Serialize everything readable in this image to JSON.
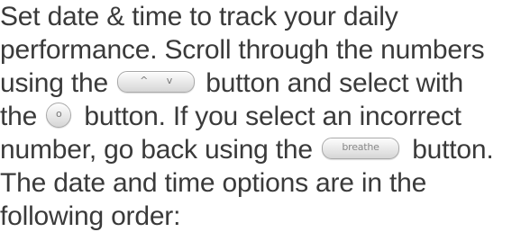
{
  "text": {
    "line1": "Set date & time to track your daily",
    "line2": "performance. Scroll through the numbers",
    "line3_before": "using the",
    "line3_after": "button and select with",
    "line4_before": "the",
    "line4_after": "button. If you select an incorrect",
    "line5_before": "number, go back using the",
    "line5_after": "button.",
    "line6": "The date and time options are in the",
    "line7": "following order:"
  },
  "buttons": {
    "scroll": {
      "icon_up": "chevron-up-icon",
      "icon_down": "chevron-down-icon",
      "up_glyph": "^",
      "down_glyph": "v"
    },
    "select": {
      "icon": "circle-icon",
      "glyph": "o"
    },
    "breathe": {
      "label": "breathe"
    }
  },
  "colors": {
    "text": "#3a3a3a",
    "button_border": "#a9a9a9",
    "button_glyph": "#777777"
  }
}
